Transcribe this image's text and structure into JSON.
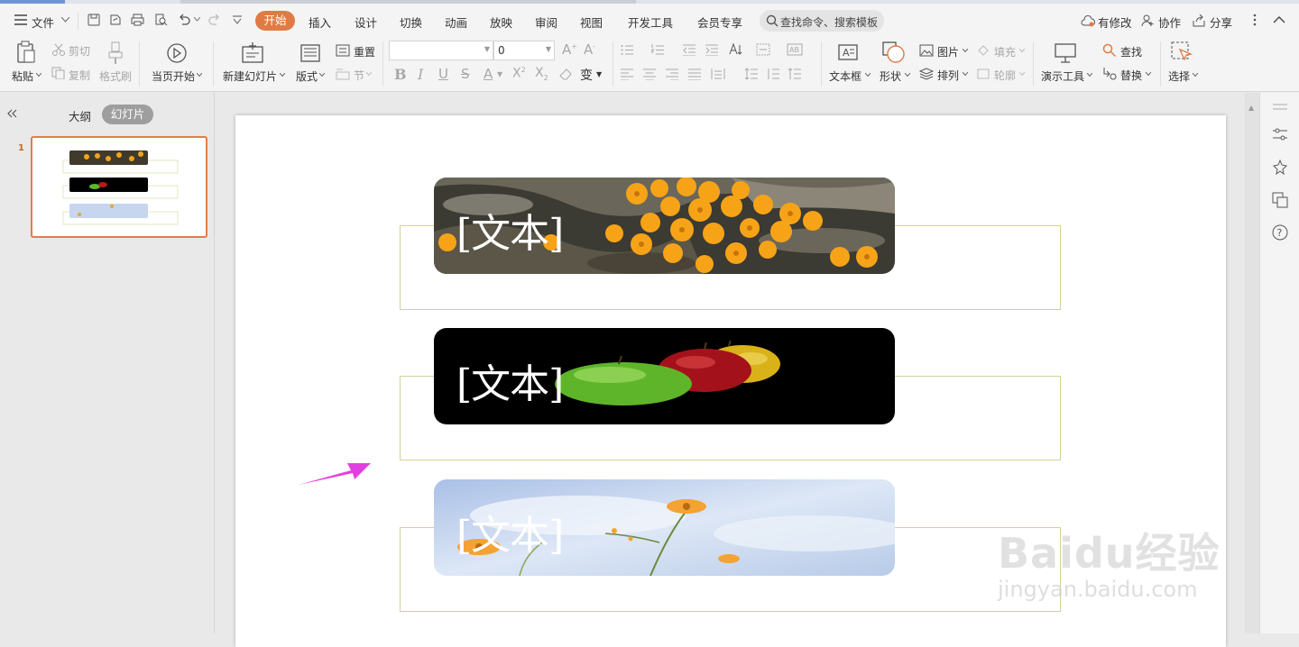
{
  "menu": {
    "file": "文件",
    "tabs": [
      "开始",
      "插入",
      "设计",
      "切换",
      "动画",
      "放映",
      "审阅",
      "视图",
      "开发工具",
      "会员专享"
    ],
    "active_tab": "开始",
    "search_placeholder": "查找命令、搜索模板",
    "right": [
      "有修改",
      "协作",
      "分享"
    ]
  },
  "ribbon": {
    "paste": "粘贴",
    "cut": "剪切",
    "copy": "复制",
    "format_painter": "格式刷",
    "play_from_current": "当页开始",
    "new_slide": "新建幻灯片",
    "layout": "版式",
    "reset": "重置",
    "section": "节",
    "font_name": "",
    "font_size": "0",
    "textbox": "文本框",
    "shape": "形状",
    "picture": "图片",
    "fill": "填充",
    "arrange": "排列",
    "outline": "轮廓",
    "presentation_tools": "演示工具",
    "find": "查找",
    "replace": "替换",
    "select": "选择"
  },
  "leftpanel": {
    "outline_tab": "大纲",
    "slides_tab": "幻灯片",
    "slide_number": "1"
  },
  "slide": {
    "items": [
      {
        "placeholder": "[文本]",
        "image": "orange-flowers"
      },
      {
        "placeholder": "[文本]",
        "image": "apples"
      },
      {
        "placeholder": "[文本]",
        "image": "sky-flowers"
      }
    ]
  },
  "watermark": {
    "logo": "Baidu经验",
    "url": "jingyan.baidu.com"
  },
  "colors": {
    "accent": "#e07b45",
    "arrow": "#e23fe0",
    "frame": "#d2d29a"
  }
}
